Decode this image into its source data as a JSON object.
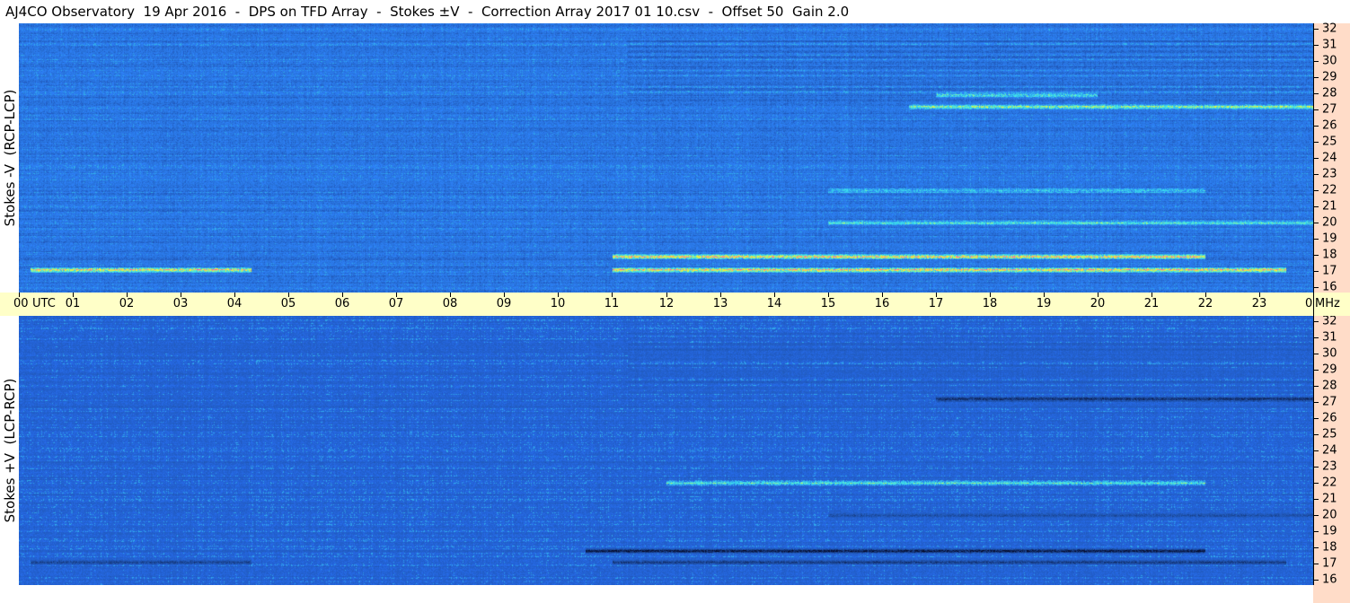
{
  "title": "AJ4CO Observatory  19 Apr 2016  -  DPS on TFD Array  -  Stokes ±V  -  Correction Array 2017 01 10.csv  -  Offset 50  Gain 2.0",
  "chart_data": {
    "type": "heatmap",
    "title": "AJ4CO Observatory  19 Apr 2016  -  DPS on TFD Array  -  Stokes ±V  -  Correction Array 2017 01 10.csv  -  Offset 50  Gain 2.0",
    "x_unit": "UTC",
    "y_unit": "MHz",
    "x_range": [
      0,
      24
    ],
    "y_range": [
      16,
      32
    ],
    "x_ticks": [
      "00",
      "01",
      "02",
      "03",
      "04",
      "05",
      "06",
      "07",
      "08",
      "09",
      "10",
      "11",
      "12",
      "13",
      "14",
      "15",
      "16",
      "17",
      "18",
      "19",
      "20",
      "21",
      "22",
      "23",
      "00"
    ],
    "y_ticks": [
      "32",
      "31",
      "30",
      "29",
      "28",
      "27",
      "26",
      "25",
      "24",
      "23",
      "22",
      "21",
      "20",
      "19",
      "18",
      "17",
      "16"
    ],
    "panels": [
      {
        "label": "Stokes -V  (RCP-LCP)",
        "base_color": "#2a78e6",
        "strong_bands": [
          {
            "f": 17.9,
            "t_start": 11.0,
            "t_end": 22.0,
            "intensity": 0.95
          },
          {
            "f": 17.1,
            "t_start": 11.0,
            "t_end": 23.5,
            "intensity": 0.9
          },
          {
            "f": 17.1,
            "t_start": 0.2,
            "t_end": 4.3,
            "intensity": 0.85
          },
          {
            "f": 27.2,
            "t_start": 16.5,
            "t_end": 24.0,
            "intensity": 0.6
          },
          {
            "f": 27.9,
            "t_start": 17.0,
            "t_end": 20.0,
            "intensity": 0.5
          },
          {
            "f": 22.0,
            "t_start": 15.0,
            "t_end": 22.0,
            "intensity": 0.35
          },
          {
            "f": 20.0,
            "t_start": 15.0,
            "t_end": 24.0,
            "intensity": 0.4
          }
        ]
      },
      {
        "label": "Stokes +V  (LCP-RCP)",
        "base_color": "#2464d8",
        "strong_bands": [
          {
            "f": 17.8,
            "t_start": 10.5,
            "t_end": 22.0,
            "intensity": -0.9
          },
          {
            "f": 17.1,
            "t_start": 11.0,
            "t_end": 23.5,
            "intensity": -0.6
          },
          {
            "f": 17.1,
            "t_start": 0.2,
            "t_end": 4.3,
            "intensity": -0.5
          },
          {
            "f": 27.2,
            "t_start": 17.0,
            "t_end": 24.0,
            "intensity": -0.7
          },
          {
            "f": 22.0,
            "t_start": 12.0,
            "t_end": 22.0,
            "intensity": 0.4
          },
          {
            "f": 20.0,
            "t_start": 15.0,
            "t_end": 24.0,
            "intensity": -0.4
          }
        ]
      }
    ]
  }
}
